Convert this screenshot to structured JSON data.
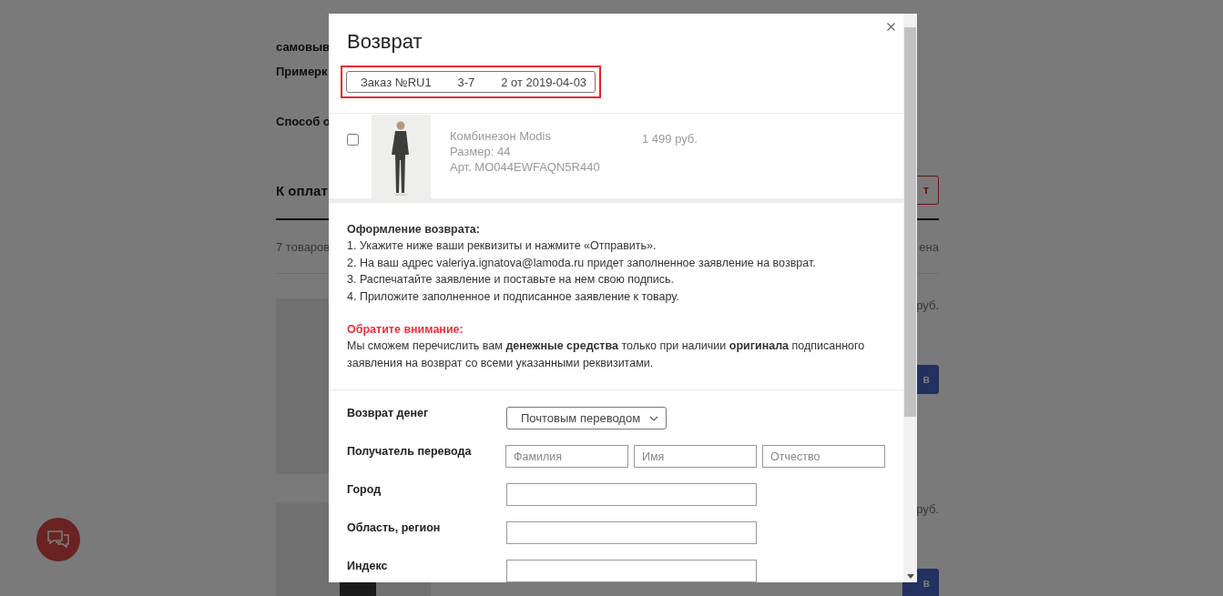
{
  "page": {
    "pickup_label": "самовыв",
    "fitting_label": "Примерк",
    "method_label": "Способ о",
    "total_title": "К оплат",
    "action_button": "т",
    "items_count": "7 товаров",
    "price_heading": "ена",
    "items": [
      {
        "price": "руб.",
        "button": "в"
      },
      {
        "price": "руб.",
        "button": "в"
      }
    ]
  },
  "dialog": {
    "title": "Возврат",
    "order_select": {
      "value": "Заказ №RU1        3-7        2 от 2019-04-03",
      "highlighted": true
    },
    "products": [
      {
        "kind": "picture",
        "name": "Комбинезон Modis",
        "size": "Размер: 44",
        "article": "Арт. MO044EWFAQN5R440",
        "price": "1 499 руб.",
        "checked": false
      }
    ],
    "instructions": {
      "title": "Оформление возврата:",
      "steps": [
        "1. Укажите ниже ваши реквизиты и нажмите «Отправить».",
        "2. На ваш адрес valeriya.ignatova@lamoda.ru придет заполненное заявление на возврат.",
        "3. Распечатайте заявление и поставьте на нем свою подпись.",
        "4. Приложите заполненное и подписанное заявление к товару."
      ]
    },
    "notice": {
      "title": "Обратите внимание:",
      "text": "Мы сможем перечислить вам **денежные средства** только при наличии **оригинала** подписанного заявления на возврат со всеми указанными реквизитами."
    },
    "form": [
      {
        "kind": "select",
        "label": "Возврат денег",
        "value": "Почтовым переводом"
      },
      {
        "kind": "name",
        "label": "Получатель перевода",
        "placeholders": [
          "Фамилия",
          "Имя",
          "Отчество"
        ]
      },
      {
        "kind": "text",
        "label": "Город"
      },
      {
        "kind": "text",
        "label": "Область, регион"
      },
      {
        "kind": "text",
        "label": "Индекс"
      }
    ]
  }
}
